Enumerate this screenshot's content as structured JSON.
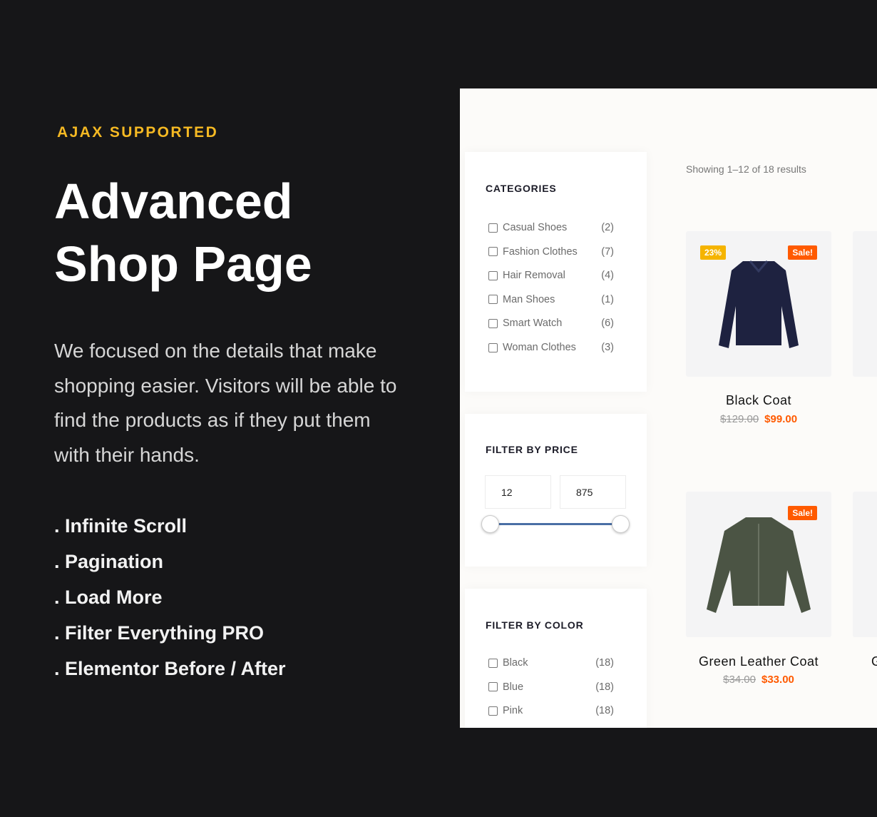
{
  "hero": {
    "eyebrow": "AJAX SUPPORTED",
    "title_line1": "Advanced",
    "title_line2": "Shop Page",
    "description": "We focused on the details that make shopping easier.  Visitors will be able to find the products as if they put them with their hands.",
    "features": [
      ". Infinite Scroll",
      ". Pagination",
      ". Load More",
      ". Filter Everything PRO",
      ". Elementor Before / After"
    ]
  },
  "shop": {
    "categories": {
      "title": "CATEGORIES",
      "items": [
        {
          "label": "Casual Shoes",
          "count": "(2)"
        },
        {
          "label": "Fashion Clothes",
          "count": "(7)"
        },
        {
          "label": "Hair Removal",
          "count": "(4)"
        },
        {
          "label": "Man Shoes",
          "count": "(1)"
        },
        {
          "label": "Smart Watch",
          "count": "(6)"
        },
        {
          "label": "Woman Clothes",
          "count": "(3)"
        }
      ]
    },
    "price_filter": {
      "title": "FILTER BY PRICE",
      "min": "12",
      "max": "875",
      "range_fraction": [
        0,
        1
      ],
      "track_color": "#4a6fa5"
    },
    "color_filter": {
      "title": "FILTER BY COLOR",
      "items": [
        {
          "label": "Black",
          "count": "(18)"
        },
        {
          "label": "Blue",
          "count": "(18)"
        },
        {
          "label": "Pink",
          "count": "(18)"
        }
      ]
    },
    "result_count": "Showing 1–12 of 18 results",
    "products": [
      {
        "name": "Black Coat",
        "old_price": "$129.00",
        "price": "$99.00",
        "discount_badge": "23%",
        "sale_badge": "Sale!"
      },
      {
        "name": "Green Leather Coat",
        "old_price": "$34.00",
        "price": "$33.00",
        "sale_badge": "Sale!"
      }
    ],
    "partial_product_name": "G"
  },
  "colors": {
    "accent": "#f5b923",
    "sale": "#ff5a00",
    "discount": "#f5b400",
    "background": "#161618"
  }
}
